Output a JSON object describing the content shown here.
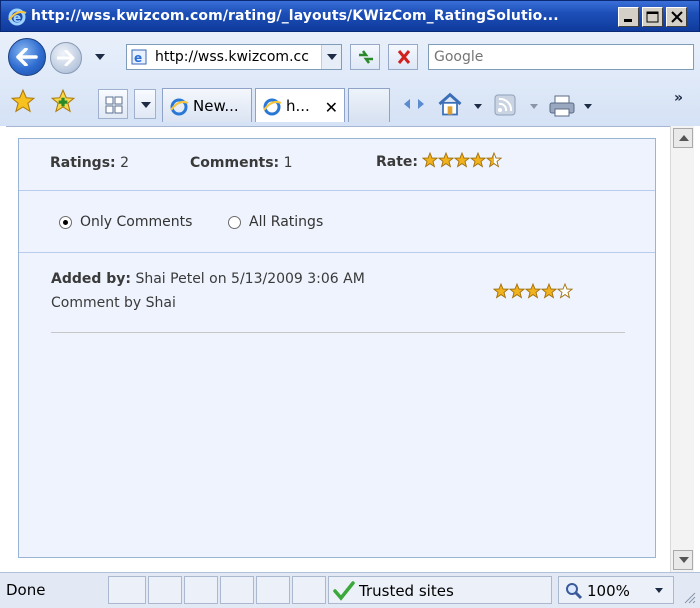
{
  "window": {
    "title": "http://wss.kwizcom.com/rating/_layouts/KWizCom_RatingSolutio..."
  },
  "toolbar": {
    "address_url": "http://wss.kwizcom.cc",
    "search_placeholder": "Google"
  },
  "tabs": [
    {
      "label": "New...",
      "active": false
    },
    {
      "label": "h...",
      "active": true
    }
  ],
  "summary": {
    "ratings_label": "Ratings:",
    "ratings_value": "2",
    "comments_label": "Comments:",
    "comments_value": "1",
    "rate_label": "Rate:",
    "rate_stars": 4.5
  },
  "filter": {
    "options": [
      {
        "label": "Only Comments",
        "selected": true
      },
      {
        "label": "All Ratings",
        "selected": false
      }
    ]
  },
  "comments": [
    {
      "added_by_label": "Added by:",
      "added_by_text": "Shai Petel on 5/13/2009 3:06 AM",
      "text": "Comment by Shai",
      "stars": 4
    }
  ],
  "statusbar": {
    "status": "Done",
    "zone": "Trusted sites",
    "zoom": "100%"
  },
  "colors": {
    "titlebar": "#1d4fb8",
    "panel_bg": "#eef3fd",
    "panel_border": "#98b5d8",
    "star_fill": "#f2b21d"
  },
  "icons": {
    "back": "back-arrow-icon",
    "forward": "forward-arrow-icon",
    "refresh": "refresh-icon",
    "stop": "stop-icon",
    "favorites": "star-icon",
    "add_favorites": "add-favorite-icon",
    "home": "home-icon",
    "feeds": "rss-icon",
    "print": "print-icon",
    "zone": "checkmark-icon",
    "zoom": "magnifier-icon"
  }
}
